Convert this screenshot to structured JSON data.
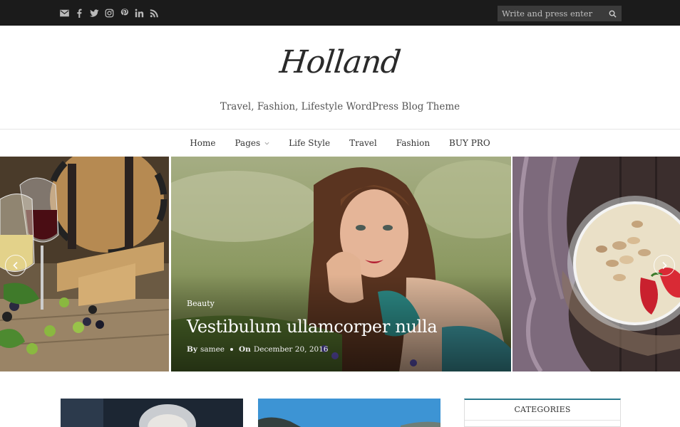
{
  "topbar": {
    "social_icons": [
      "email-icon",
      "facebook-icon",
      "twitter-icon",
      "instagram-icon",
      "pinterest-icon",
      "linkedin-icon",
      "rss-icon"
    ],
    "search_placeholder": "Write and press enter"
  },
  "header": {
    "logo": "Holland",
    "tagline": "Travel, Fashion, Lifestyle WordPress Blog Theme"
  },
  "nav": {
    "items": [
      "Home",
      "Pages",
      "Life Style",
      "Travel",
      "Fashion",
      "BUY PRO"
    ]
  },
  "slider": {
    "featured": {
      "category": "Beauty",
      "title": "Vestibulum ullamcorper nulla",
      "by_label": "By",
      "author": "samee",
      "on_label": "On",
      "date": "December 20, 2016"
    }
  },
  "sidebar": {
    "widget_title": "CATEGORIES"
  },
  "colors": {
    "topbar_bg": "#1b1b1b",
    "widget_accent": "#2b7a8e"
  }
}
